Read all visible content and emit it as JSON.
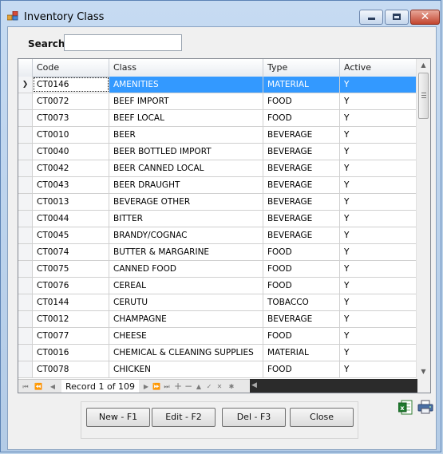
{
  "window": {
    "title": "Inventory Class",
    "close_glyph": "✕"
  },
  "search": {
    "label": "Search",
    "value": ""
  },
  "grid": {
    "columns": [
      "Code",
      "Class",
      "Type",
      "Active"
    ],
    "selected_row_marker": "❯",
    "rows": [
      {
        "code": "CT0146",
        "class": "AMENITIES",
        "type": "MATERIAL",
        "active": "Y"
      },
      {
        "code": "CT0072",
        "class": "BEEF IMPORT",
        "type": "FOOD",
        "active": "Y"
      },
      {
        "code": "CT0073",
        "class": "BEEF LOCAL",
        "type": "FOOD",
        "active": "Y"
      },
      {
        "code": "CT0010",
        "class": "BEER",
        "type": "BEVERAGE",
        "active": "Y"
      },
      {
        "code": "CT0040",
        "class": "BEER BOTTLED IMPORT",
        "type": "BEVERAGE",
        "active": "Y"
      },
      {
        "code": "CT0042",
        "class": "BEER CANNED LOCAL",
        "type": "BEVERAGE",
        "active": "Y"
      },
      {
        "code": "CT0043",
        "class": "BEER DRAUGHT",
        "type": "BEVERAGE",
        "active": "Y"
      },
      {
        "code": "CT0013",
        "class": "BEVERAGE OTHER",
        "type": "BEVERAGE",
        "active": "Y"
      },
      {
        "code": "CT0044",
        "class": "BITTER",
        "type": "BEVERAGE",
        "active": "Y"
      },
      {
        "code": "CT0045",
        "class": "BRANDY/COGNAC",
        "type": "BEVERAGE",
        "active": "Y"
      },
      {
        "code": "CT0074",
        "class": "BUTTER & MARGARINE",
        "type": "FOOD",
        "active": "Y"
      },
      {
        "code": "CT0075",
        "class": "CANNED FOOD",
        "type": "FOOD",
        "active": "Y"
      },
      {
        "code": "CT0076",
        "class": "CEREAL",
        "type": "FOOD",
        "active": "Y"
      },
      {
        "code": "CT0144",
        "class": "CERUTU",
        "type": "TOBACCO",
        "active": "Y"
      },
      {
        "code": "CT0012",
        "class": "CHAMPAGNE",
        "type": "BEVERAGE",
        "active": "Y"
      },
      {
        "code": "CT0077",
        "class": "CHEESE",
        "type": "FOOD",
        "active": "Y"
      },
      {
        "code": "CT0016",
        "class": "CHEMICAL & CLEANING SUPPLIES",
        "type": "MATERIAL",
        "active": "Y"
      },
      {
        "code": "CT0078",
        "class": "CHICKEN",
        "type": "FOOD",
        "active": "Y"
      }
    ]
  },
  "navigator": {
    "record_text": "Record 1 of 109"
  },
  "buttons": {
    "new": "New - F1",
    "edit": "Edit - F2",
    "delete": "Del - F3",
    "close": "Close"
  },
  "icons": {
    "excel": "excel-icon",
    "print": "print-icon"
  }
}
